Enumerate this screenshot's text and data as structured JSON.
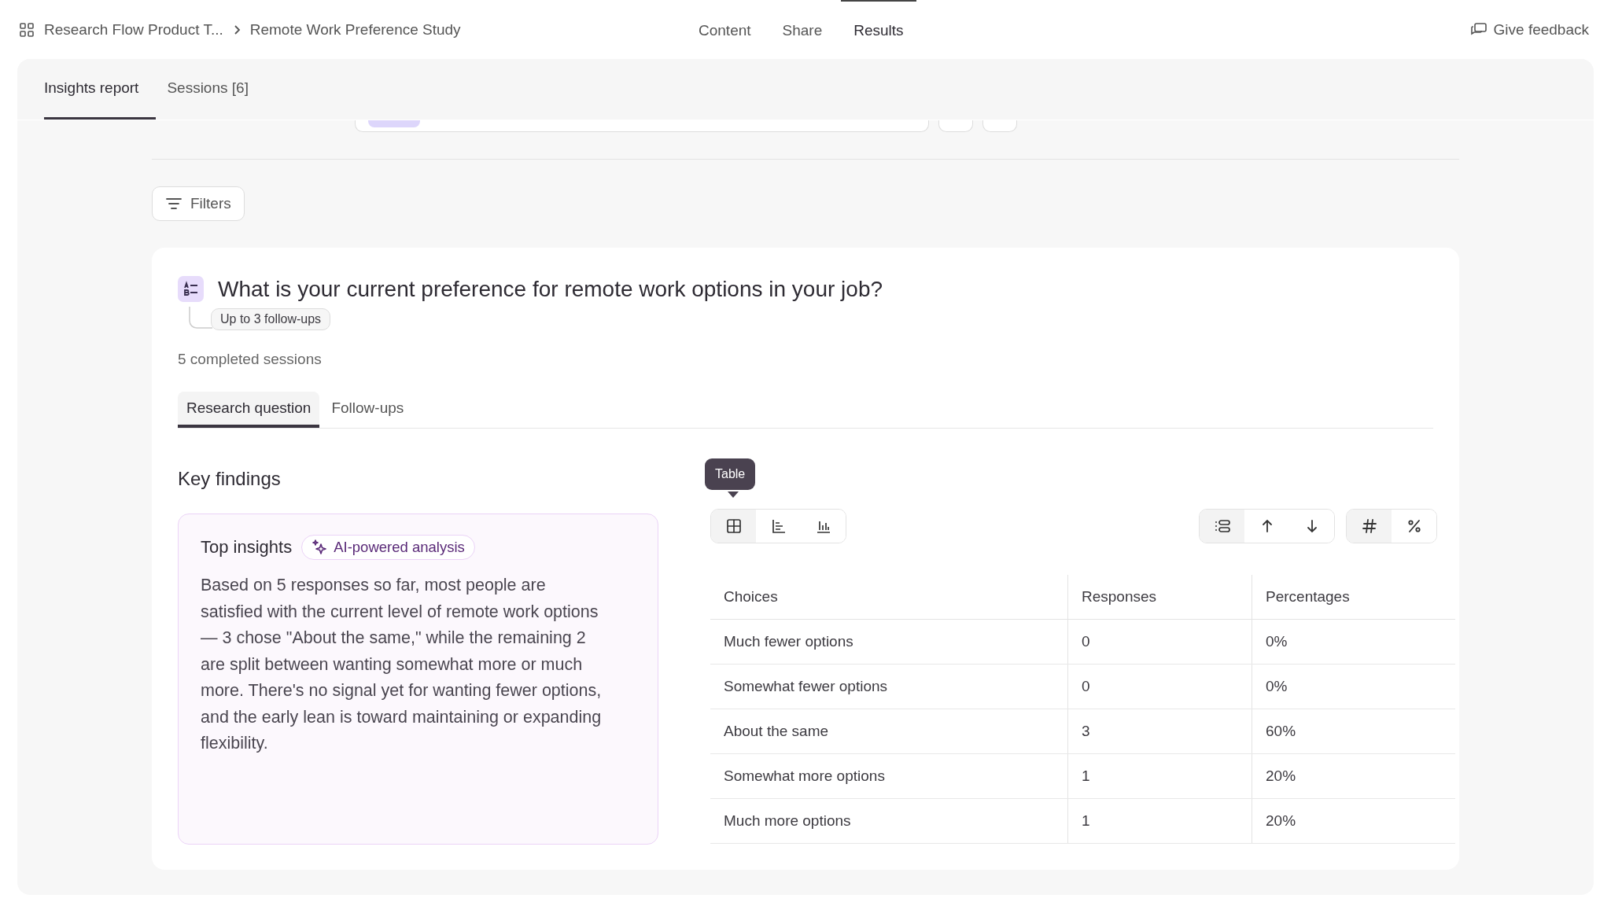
{
  "breadcrumb": [
    {
      "label": "Research Flow Product T..."
    },
    {
      "label": "Remote Work Preference Study"
    }
  ],
  "nav": [
    {
      "label": "Content",
      "selected": false
    },
    {
      "label": "Share",
      "selected": false
    },
    {
      "label": "Results",
      "selected": true
    }
  ],
  "feedback_button": {
    "label": "Give feedback"
  },
  "report_tabs": [
    {
      "label": "Insights report",
      "selected": true
    },
    {
      "label": "Sessions [6]",
      "selected": false
    }
  ],
  "filters_button": {
    "label": "Filters"
  },
  "question": {
    "title": "What is your current preference for remote work options in your job?",
    "follow_up_badge": "Up to 3 follow-ups",
    "sessions": "5 completed sessions"
  },
  "question_tabs": [
    {
      "label": "Research question",
      "selected": true
    },
    {
      "label": "Follow-ups",
      "selected": false
    }
  ],
  "key_findings": {
    "heading": "Key findings",
    "title": "Top insights",
    "badge": "AI-powered analysis",
    "text": "Based on 5 responses so far, most people are satisfied with the current level of remote work options — 3 chose \"About the same,\" while the remaining 2 are split between wanting somewhat more or much more. There's no signal yet for wanting fewer options, and the early lean is toward maintaining or expanding flexibility."
  },
  "tooltip": "Table",
  "view_toggle": [
    {
      "kind": "table",
      "selected": true
    },
    {
      "kind": "bars_horizontal",
      "selected": false
    },
    {
      "kind": "bars_vertical",
      "selected": false
    }
  ],
  "sort_toggle": [
    {
      "kind": "default",
      "selected": true
    },
    {
      "kind": "ascending",
      "selected": false
    },
    {
      "kind": "descending",
      "selected": false
    }
  ],
  "format_toggle": [
    {
      "kind": "count",
      "selected": true
    },
    {
      "kind": "percent",
      "selected": false
    }
  ],
  "table": {
    "columns": [
      "Choices",
      "Responses",
      "Percentages"
    ],
    "rows": [
      [
        "Much fewer options",
        "0",
        "0%"
      ],
      [
        "Somewhat fewer options",
        "0",
        "0%"
      ],
      [
        "About the same",
        "3",
        "60%"
      ],
      [
        "Somewhat more options",
        "1",
        "20%"
      ],
      [
        "Much more options",
        "1",
        "20%"
      ]
    ]
  }
}
